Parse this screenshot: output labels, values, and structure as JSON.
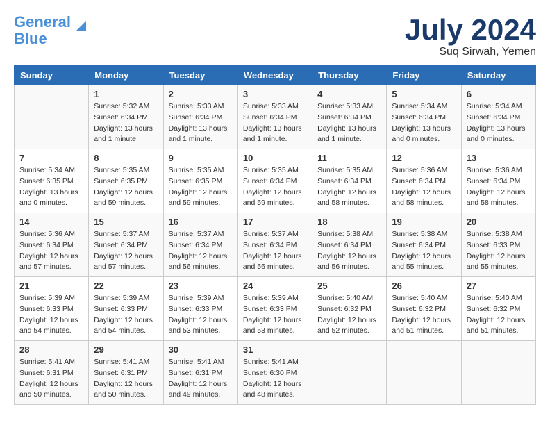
{
  "header": {
    "logo_line1": "General",
    "logo_line2": "Blue",
    "title": "July 2024",
    "subtitle": "Suq Sirwah, Yemen"
  },
  "days_of_week": [
    "Sunday",
    "Monday",
    "Tuesday",
    "Wednesday",
    "Thursday",
    "Friday",
    "Saturday"
  ],
  "weeks": [
    [
      {
        "day": "",
        "detail": ""
      },
      {
        "day": "1",
        "detail": "Sunrise: 5:32 AM\nSunset: 6:34 PM\nDaylight: 13 hours\nand 1 minute."
      },
      {
        "day": "2",
        "detail": "Sunrise: 5:33 AM\nSunset: 6:34 PM\nDaylight: 13 hours\nand 1 minute."
      },
      {
        "day": "3",
        "detail": "Sunrise: 5:33 AM\nSunset: 6:34 PM\nDaylight: 13 hours\nand 1 minute."
      },
      {
        "day": "4",
        "detail": "Sunrise: 5:33 AM\nSunset: 6:34 PM\nDaylight: 13 hours\nand 1 minute."
      },
      {
        "day": "5",
        "detail": "Sunrise: 5:34 AM\nSunset: 6:34 PM\nDaylight: 13 hours\nand 0 minutes."
      },
      {
        "day": "6",
        "detail": "Sunrise: 5:34 AM\nSunset: 6:34 PM\nDaylight: 13 hours\nand 0 minutes."
      }
    ],
    [
      {
        "day": "7",
        "detail": "Sunrise: 5:34 AM\nSunset: 6:35 PM\nDaylight: 13 hours\nand 0 minutes."
      },
      {
        "day": "8",
        "detail": "Sunrise: 5:35 AM\nSunset: 6:35 PM\nDaylight: 12 hours\nand 59 minutes."
      },
      {
        "day": "9",
        "detail": "Sunrise: 5:35 AM\nSunset: 6:35 PM\nDaylight: 12 hours\nand 59 minutes."
      },
      {
        "day": "10",
        "detail": "Sunrise: 5:35 AM\nSunset: 6:34 PM\nDaylight: 12 hours\nand 59 minutes."
      },
      {
        "day": "11",
        "detail": "Sunrise: 5:35 AM\nSunset: 6:34 PM\nDaylight: 12 hours\nand 58 minutes."
      },
      {
        "day": "12",
        "detail": "Sunrise: 5:36 AM\nSunset: 6:34 PM\nDaylight: 12 hours\nand 58 minutes."
      },
      {
        "day": "13",
        "detail": "Sunrise: 5:36 AM\nSunset: 6:34 PM\nDaylight: 12 hours\nand 58 minutes."
      }
    ],
    [
      {
        "day": "14",
        "detail": "Sunrise: 5:36 AM\nSunset: 6:34 PM\nDaylight: 12 hours\nand 57 minutes."
      },
      {
        "day": "15",
        "detail": "Sunrise: 5:37 AM\nSunset: 6:34 PM\nDaylight: 12 hours\nand 57 minutes."
      },
      {
        "day": "16",
        "detail": "Sunrise: 5:37 AM\nSunset: 6:34 PM\nDaylight: 12 hours\nand 56 minutes."
      },
      {
        "day": "17",
        "detail": "Sunrise: 5:37 AM\nSunset: 6:34 PM\nDaylight: 12 hours\nand 56 minutes."
      },
      {
        "day": "18",
        "detail": "Sunrise: 5:38 AM\nSunset: 6:34 PM\nDaylight: 12 hours\nand 56 minutes."
      },
      {
        "day": "19",
        "detail": "Sunrise: 5:38 AM\nSunset: 6:34 PM\nDaylight: 12 hours\nand 55 minutes."
      },
      {
        "day": "20",
        "detail": "Sunrise: 5:38 AM\nSunset: 6:33 PM\nDaylight: 12 hours\nand 55 minutes."
      }
    ],
    [
      {
        "day": "21",
        "detail": "Sunrise: 5:39 AM\nSunset: 6:33 PM\nDaylight: 12 hours\nand 54 minutes."
      },
      {
        "day": "22",
        "detail": "Sunrise: 5:39 AM\nSunset: 6:33 PM\nDaylight: 12 hours\nand 54 minutes."
      },
      {
        "day": "23",
        "detail": "Sunrise: 5:39 AM\nSunset: 6:33 PM\nDaylight: 12 hours\nand 53 minutes."
      },
      {
        "day": "24",
        "detail": "Sunrise: 5:39 AM\nSunset: 6:33 PM\nDaylight: 12 hours\nand 53 minutes."
      },
      {
        "day": "25",
        "detail": "Sunrise: 5:40 AM\nSunset: 6:32 PM\nDaylight: 12 hours\nand 52 minutes."
      },
      {
        "day": "26",
        "detail": "Sunrise: 5:40 AM\nSunset: 6:32 PM\nDaylight: 12 hours\nand 51 minutes."
      },
      {
        "day": "27",
        "detail": "Sunrise: 5:40 AM\nSunset: 6:32 PM\nDaylight: 12 hours\nand 51 minutes."
      }
    ],
    [
      {
        "day": "28",
        "detail": "Sunrise: 5:41 AM\nSunset: 6:31 PM\nDaylight: 12 hours\nand 50 minutes."
      },
      {
        "day": "29",
        "detail": "Sunrise: 5:41 AM\nSunset: 6:31 PM\nDaylight: 12 hours\nand 50 minutes."
      },
      {
        "day": "30",
        "detail": "Sunrise: 5:41 AM\nSunset: 6:31 PM\nDaylight: 12 hours\nand 49 minutes."
      },
      {
        "day": "31",
        "detail": "Sunrise: 5:41 AM\nSunset: 6:30 PM\nDaylight: 12 hours\nand 48 minutes."
      },
      {
        "day": "",
        "detail": ""
      },
      {
        "day": "",
        "detail": ""
      },
      {
        "day": "",
        "detail": ""
      }
    ]
  ]
}
